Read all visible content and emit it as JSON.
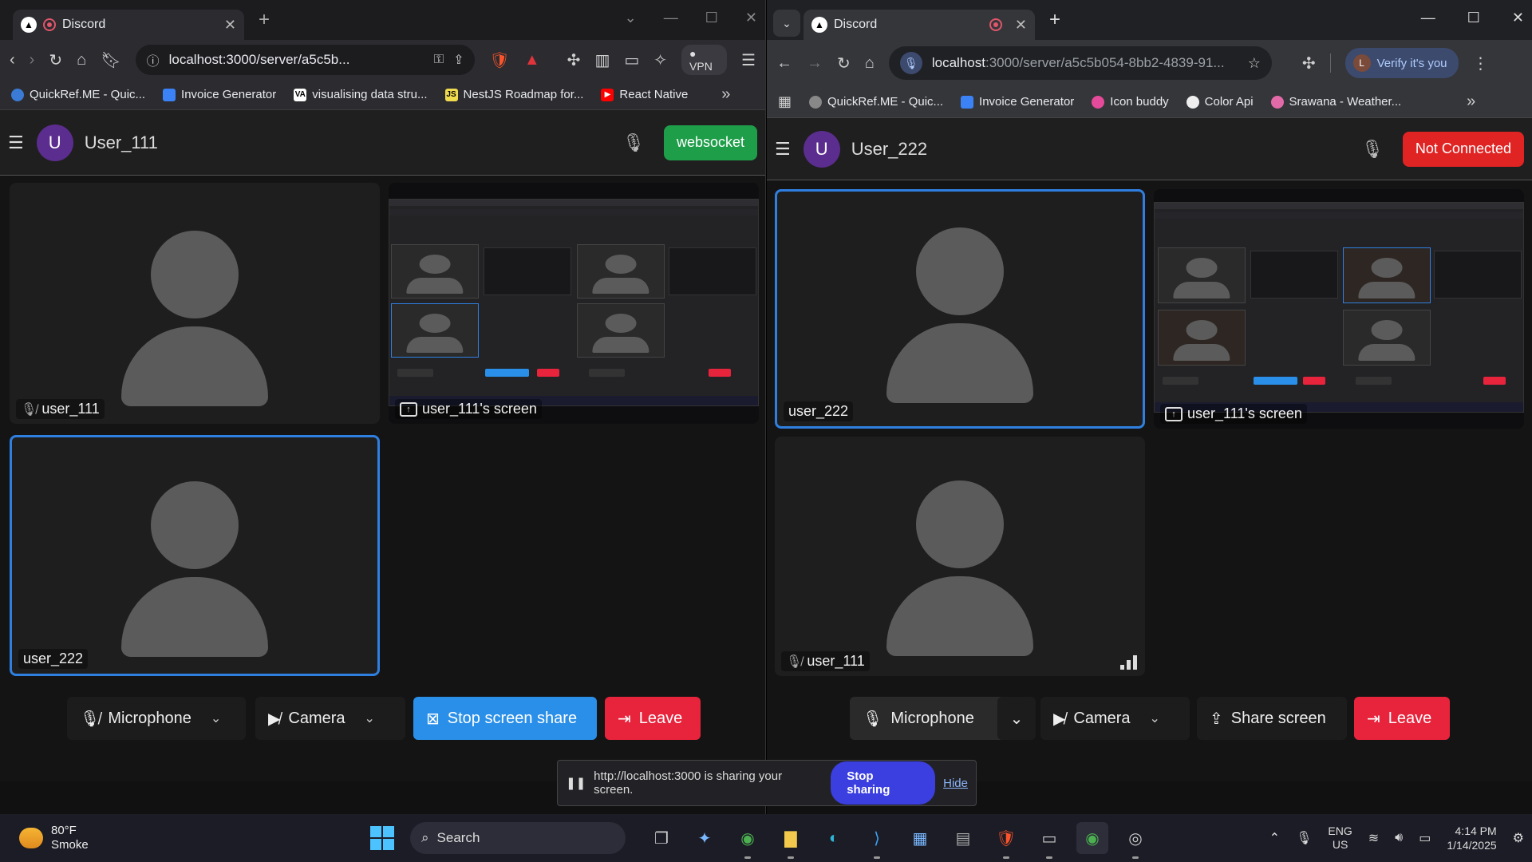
{
  "left": {
    "tab_title": "Discord",
    "url": "localhost:3000/server/a5c5b...",
    "vpn_label": "VPN",
    "bookmarks": [
      {
        "label": "QuickRef.ME - Quic...",
        "color": "#3a7bd5"
      },
      {
        "label": "Invoice Generator",
        "color": "#3b82f6"
      },
      {
        "label": "visualising data stru...",
        "color": "#111111"
      },
      {
        "label": "NestJS Roadmap for...",
        "color": "#f0db4f"
      },
      {
        "label": "React Native",
        "color": "#ff0000"
      }
    ],
    "user_initial": "U",
    "username": "User_111",
    "status_label": "websocket",
    "tiles": {
      "user_a": "user_111",
      "screen": "user_111's screen",
      "user_b": "user_222"
    },
    "controls": {
      "microphone": "Microphone",
      "camera": "Camera",
      "share": "Stop screen share",
      "leave": "Leave"
    }
  },
  "right": {
    "tab_title": "Discord",
    "url_host": "localhost",
    "url_rest": ":3000/server/a5c5b054-8bb2-4839-91...",
    "verify_label": "Verify it's you",
    "verify_initial": "L",
    "bookmarks": [
      {
        "label": "QuickRef.ME - Quic...",
        "color": "#3a7bd5"
      },
      {
        "label": "Invoice Generator",
        "color": "#3b82f6"
      },
      {
        "label": "Icon buddy",
        "color": "#e64a9a"
      },
      {
        "label": "Color Api",
        "color": "#eeeeee"
      },
      {
        "label": "Srawana - Weather...",
        "color": "#e36aa8"
      }
    ],
    "user_initial": "U",
    "username": "User_222",
    "status_label": "Not Connected",
    "tiles": {
      "user_a": "user_222",
      "screen": "user_111's screen",
      "user_b": "user_111"
    },
    "controls": {
      "microphone": "Microphone",
      "camera": "Camera",
      "share": "Share screen",
      "leave": "Leave"
    }
  },
  "share_banner": {
    "text": "http://localhost:3000 is sharing your screen.",
    "stop": "Stop sharing",
    "hide": "Hide"
  },
  "taskbar": {
    "temp": "80°F",
    "condition": "Smoke",
    "search": "Search",
    "lang1": "ENG",
    "lang2": "US",
    "time": "4:14 PM",
    "date": "1/14/2025"
  }
}
